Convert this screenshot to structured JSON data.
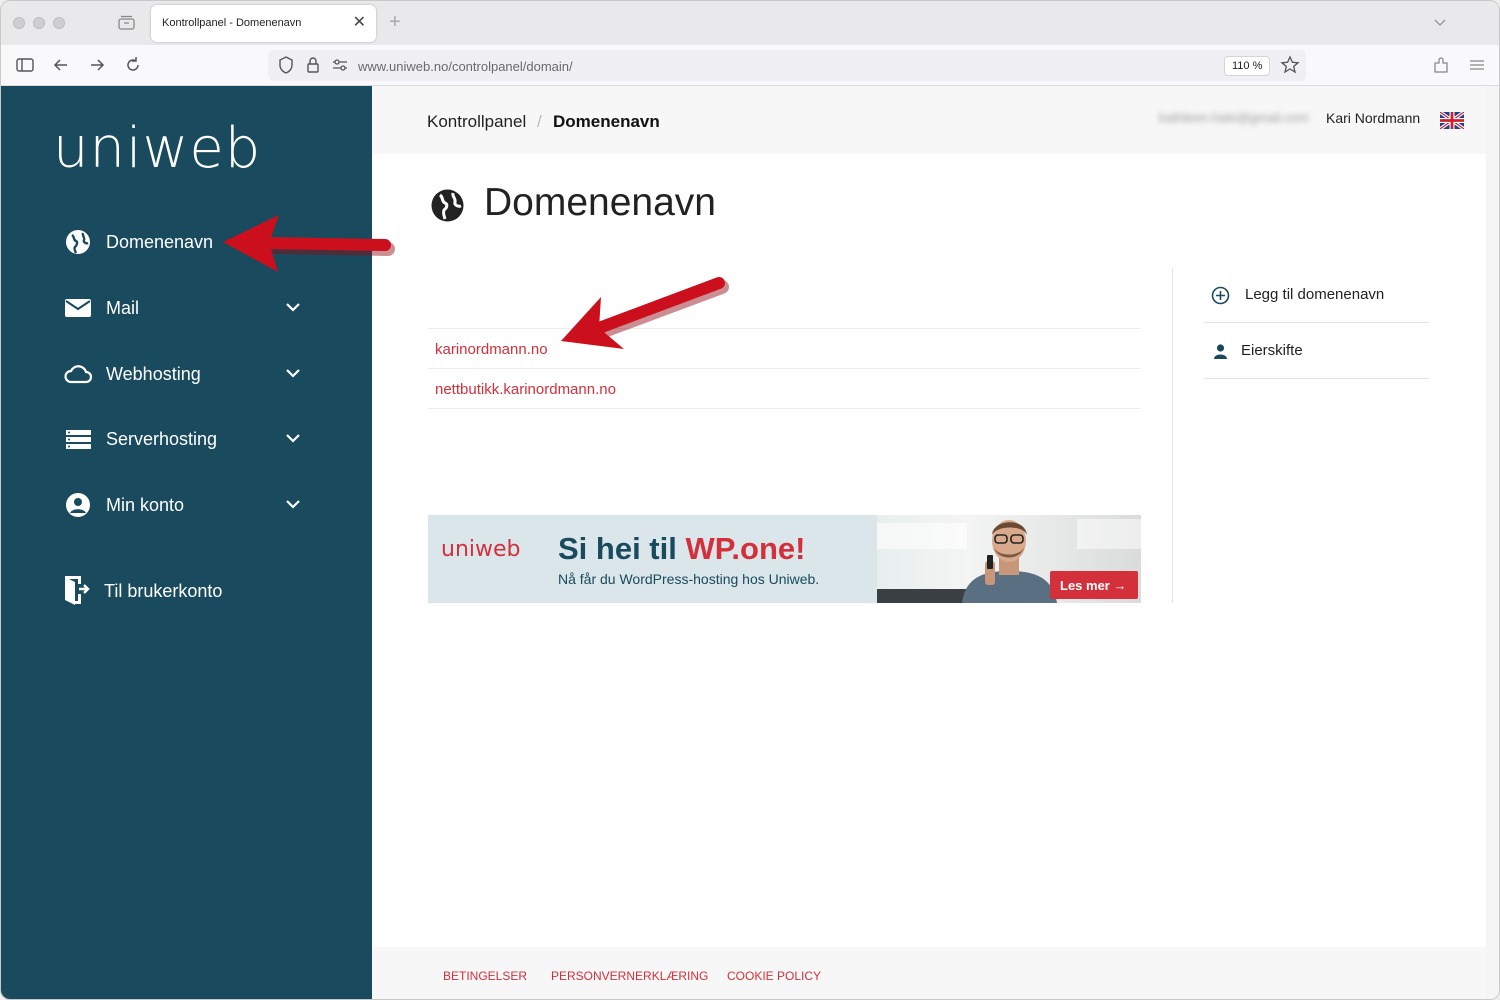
{
  "browser": {
    "tab_title": "Kontrollpanel - Domenenavn",
    "tab_close": "✕",
    "new_tab": "+",
    "url_path": "www.uniweb.no/controlpanel/domain/",
    "url_host": "uniweb.no",
    "zoom": "110 %"
  },
  "sidebar": {
    "logo": "uniweb",
    "items": [
      {
        "label": "Domenenavn",
        "icon": "globe-icon"
      },
      {
        "label": "Mail",
        "icon": "envelope-icon"
      },
      {
        "label": "Webhosting",
        "icon": "cloud-icon"
      },
      {
        "label": "Serverhosting",
        "icon": "server-icon"
      },
      {
        "label": "Min konto",
        "icon": "user-circle-icon"
      },
      {
        "label": "Til brukerkonto",
        "icon": "exit-icon"
      }
    ]
  },
  "topbar": {
    "breadcrumb_root": "Kontrollpanel",
    "breadcrumb_sep": "/",
    "breadcrumb_current": "Domenenavn",
    "email": "kathleen.hale@gmail.com",
    "user_name": "Kari Nordmann"
  },
  "main": {
    "title": "Domenenavn",
    "domains": [
      "karinordmann.no",
      "nettbutikk.karinordmann.no"
    ]
  },
  "actions": {
    "add_domain": "Legg til domenenavn",
    "owner_change": "Eierskifte"
  },
  "banner": {
    "logo": "uniweb",
    "title_prefix": "Si hei til ",
    "title_accent": "WP.one!",
    "subtitle": "Nå får du WordPress-hosting hos Uniweb.",
    "cta": "Les mer →"
  },
  "footer": {
    "links": [
      "BETINGELSER",
      "PERSONVERNERKLÆRING",
      "COOKIE POLICY"
    ]
  },
  "colors": {
    "sidebar_bg": "#194a5e",
    "accent_red": "#d3303c",
    "annotation_arrow": "#cc0f1c"
  }
}
